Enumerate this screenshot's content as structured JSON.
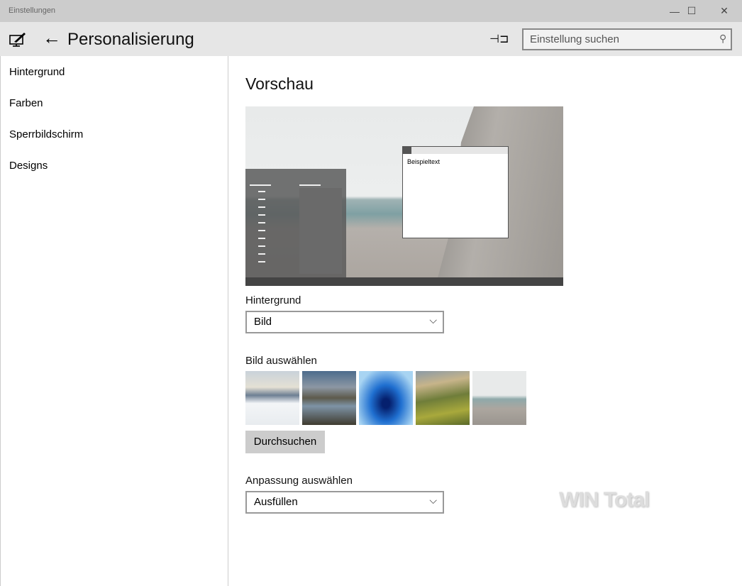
{
  "window": {
    "title": "Einstellungen",
    "minimize": "—",
    "maximize": "☐",
    "close": "✕"
  },
  "header": {
    "back": "←",
    "title": "Personalisierung",
    "pin": "⊣⊐",
    "search_placeholder": "Einstellung suchen",
    "search_icon": "⚲"
  },
  "sidebar": {
    "items": [
      {
        "label": "Hintergrund"
      },
      {
        "label": "Farben"
      },
      {
        "label": "Sperrbildschirm"
      },
      {
        "label": "Designs"
      }
    ]
  },
  "main": {
    "preview_title": "Vorschau",
    "preview_sample_text": "Beispieltext",
    "background_label": "Hintergrund",
    "background_value": "Bild",
    "choose_image_label": "Bild auswählen",
    "browse_label": "Durchsuchen",
    "fit_label": "Anpassung auswählen",
    "fit_value": "Ausfüllen",
    "chevron": "⌵"
  },
  "watermark": "WIN Total"
}
